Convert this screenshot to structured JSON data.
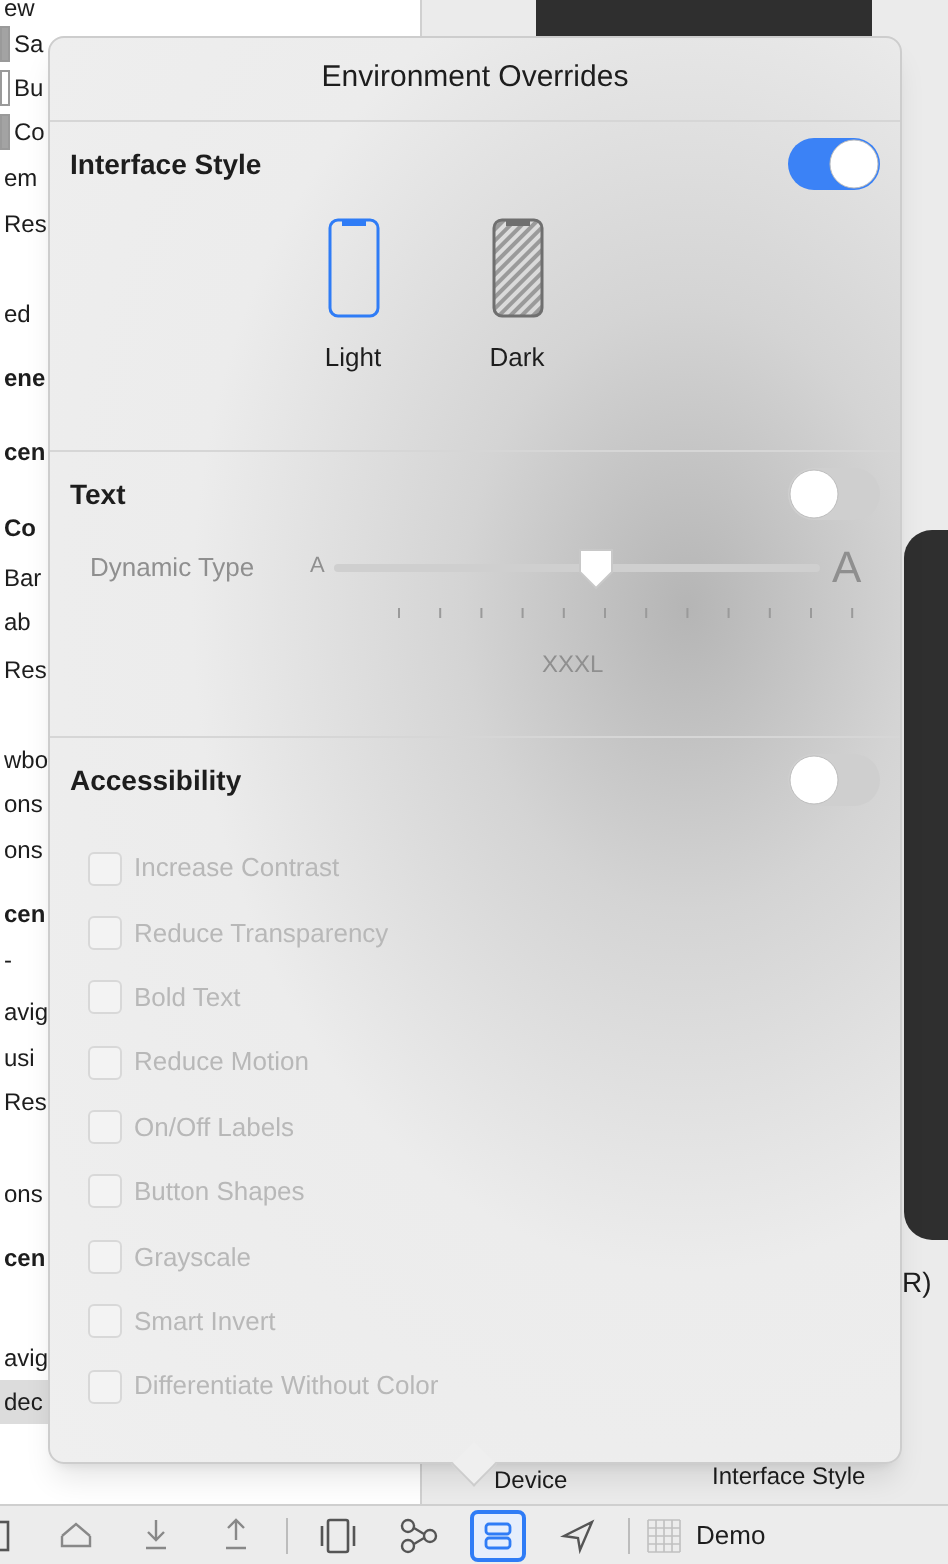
{
  "sidebar": [
    {
      "text": "ew",
      "kind": "item"
    },
    {
      "text": "Sa",
      "kind": "item",
      "color": "#a3a3a3"
    },
    {
      "text": "Bu",
      "kind": "item",
      "color": "#ffffff"
    },
    {
      "text": "Co",
      "kind": "item",
      "color": "#a3a3a3"
    },
    {
      "text": "em",
      "kind": "item"
    },
    {
      "text": "Res",
      "kind": "item"
    },
    {
      "text": "ed",
      "kind": "item"
    },
    {
      "text": "ene",
      "kind": "heading"
    },
    {
      "text": "cen",
      "kind": "heading"
    },
    {
      "text": "Co",
      "kind": "heading"
    },
    {
      "text": "Bar",
      "kind": "item"
    },
    {
      "text": "ab",
      "kind": "item"
    },
    {
      "text": "Res",
      "kind": "item"
    },
    {
      "text": "wbo",
      "kind": "item"
    },
    {
      "text": "ons",
      "kind": "item"
    },
    {
      "text": "ons",
      "kind": "item"
    },
    {
      "text": "cen",
      "kind": "heading"
    },
    {
      "text": "-",
      "kind": "item"
    },
    {
      "text": "avig",
      "kind": "item"
    },
    {
      "text": "usi",
      "kind": "item"
    },
    {
      "text": "Res",
      "kind": "item"
    },
    {
      "text": "ons",
      "kind": "item"
    },
    {
      "text": "cen",
      "kind": "heading"
    },
    {
      "text": "avig",
      "kind": "item"
    },
    {
      "text": "dec",
      "kind": "item",
      "selected": true
    }
  ],
  "canvas_labels": [
    "R)",
    "Device",
    "Interface Style"
  ],
  "popover": {
    "title": "Environment Overrides",
    "interface_style": {
      "label": "Interface Style",
      "on": true,
      "options": [
        {
          "label": "Light",
          "kind": "light",
          "selected": true
        },
        {
          "label": "Dark",
          "kind": "dark",
          "selected": false
        }
      ]
    },
    "text": {
      "label": "Text",
      "on": false,
      "dynamic_type": {
        "label": "Dynamic Type",
        "min_label": "A",
        "max_label": "A",
        "level": 0.54,
        "value": "XXXL"
      }
    },
    "accessibility": {
      "label": "Accessibility",
      "on": false,
      "options": [
        {
          "label": "Increase Contrast",
          "checked": false
        },
        {
          "label": "Reduce Transparency",
          "checked": false
        },
        {
          "label": "Bold Text",
          "checked": false
        },
        {
          "label": "Reduce Motion",
          "checked": false
        },
        {
          "label": "On/Off Labels",
          "checked": false
        },
        {
          "label": "Button Shapes",
          "checked": false
        },
        {
          "label": "Grayscale",
          "checked": false
        },
        {
          "label": "Smart Invert",
          "checked": false
        },
        {
          "label": "Differentiate Without Color",
          "checked": false
        }
      ]
    }
  },
  "toolbar": {
    "buttons": [
      {
        "kind": "sidebar",
        "selected": false
      },
      {
        "kind": "home",
        "selected": false
      },
      {
        "kind": "download",
        "selected": false
      },
      {
        "kind": "upload",
        "selected": false
      },
      {
        "kind": "separator"
      },
      {
        "kind": "device",
        "selected": false
      },
      {
        "kind": "graph",
        "selected": false
      },
      {
        "kind": "overrides",
        "selected": true
      },
      {
        "kind": "location",
        "selected": false
      },
      {
        "kind": "separator"
      }
    ],
    "scheme": "Demo"
  }
}
